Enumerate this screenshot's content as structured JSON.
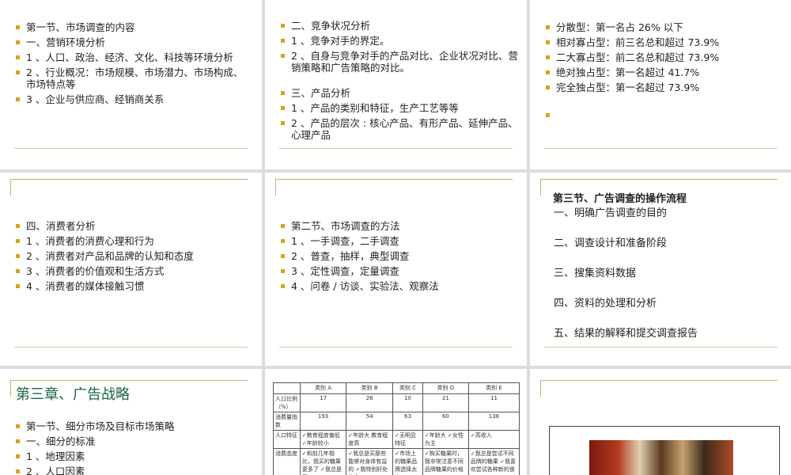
{
  "slide1": {
    "items": [
      "第一节、市场调查的内容",
      "一、营销环境分析",
      "1 、人口、政治、经济、文化、科技等环境分析",
      "2 、行业概况：市场规模、市场潜力、市场构成、市场特点等",
      "3 、企业与供应商、经销商关系"
    ]
  },
  "slide2": {
    "group1": [
      "二、竞争状况分析",
      "1 、竞争对手的界定。",
      "2 、自身与竞争对手的产品对比、企业状况对比、营销策略和广告策略的对比。"
    ],
    "group2": [
      "三、产品分析",
      "1 、产品的类别和特征，生产工艺等等",
      "2 、产品的层次 : 核心产品、有形产品、延伸产品、心理产品"
    ]
  },
  "slide3": {
    "items": [
      "分散型：第一名占 26% 以下",
      "相对寡占型：前三名总和超过 73.9%",
      "二大寡占型：前二名总和超过 73.9%",
      "绝对独占型：第一名超过 41.7%",
      "完全独占型：第一名超过 73.9%",
      ""
    ]
  },
  "slide4": {
    "items": [
      "四、消费者分析",
      "1 、消费者的消费心理和行为",
      "2 、消费者对产品和品牌的认知和态度",
      "3 、消费者的价值观和生活方式",
      "4 、消费者的媒体接触习惯"
    ]
  },
  "slide5": {
    "items": [
      "第二节、市场调查的方法",
      "1 、一手调查，二手调查",
      "2 、普查，抽样，典型调查",
      "3 、定性调查，定量调查",
      "4 、问卷 / 访谈、实验法、观察法"
    ]
  },
  "slide6": {
    "title": "第三节、广告调查的操作流程",
    "steps": [
      "一、明确广告调查的目的",
      "二、调查设计和准备阶段",
      "三、搜集资料数据",
      "四、资料的处理和分析",
      "五、结果的解释和提交调查报告"
    ]
  },
  "slide7": {
    "chapter": "第三章、广告战略",
    "items": [
      "第一节、细分市场及目标市场策略",
      "一、细分的标准",
      "1 、地理因素",
      "2 、人口因素"
    ]
  },
  "slide8": {
    "header": [
      "",
      "类别 A",
      "类别 B",
      "类别 C",
      "类别 D",
      "类别 E"
    ],
    "rows": [
      [
        "人口比例（%）",
        "17",
        "26",
        "10",
        "21",
        "11"
      ],
      [
        "消费量指数",
        "193",
        "54",
        "63",
        "60",
        "138"
      ],
      [
        "人口特征",
        "✓教育程度偏低 ✓年龄较小",
        "✓年龄大 教育程度高",
        "✓无明显特征",
        "✓年龄大 ✓女性为主",
        "✓高收入"
      ],
      [
        "消费态度",
        "✓和前几年相比，我买的糖果更多了 ✓我总是买",
        "✓我总是买那些能够对身体有益的 ✓我特别好处的食",
        "✓市场上的糖果品牌选择太少",
        "✓购买糖果时，我非常注意不同品牌糖果的价格",
        "✓我总是尝试不同品牌的糖果 ✓我喜欢尝试各种新的食"
      ]
    ]
  }
}
